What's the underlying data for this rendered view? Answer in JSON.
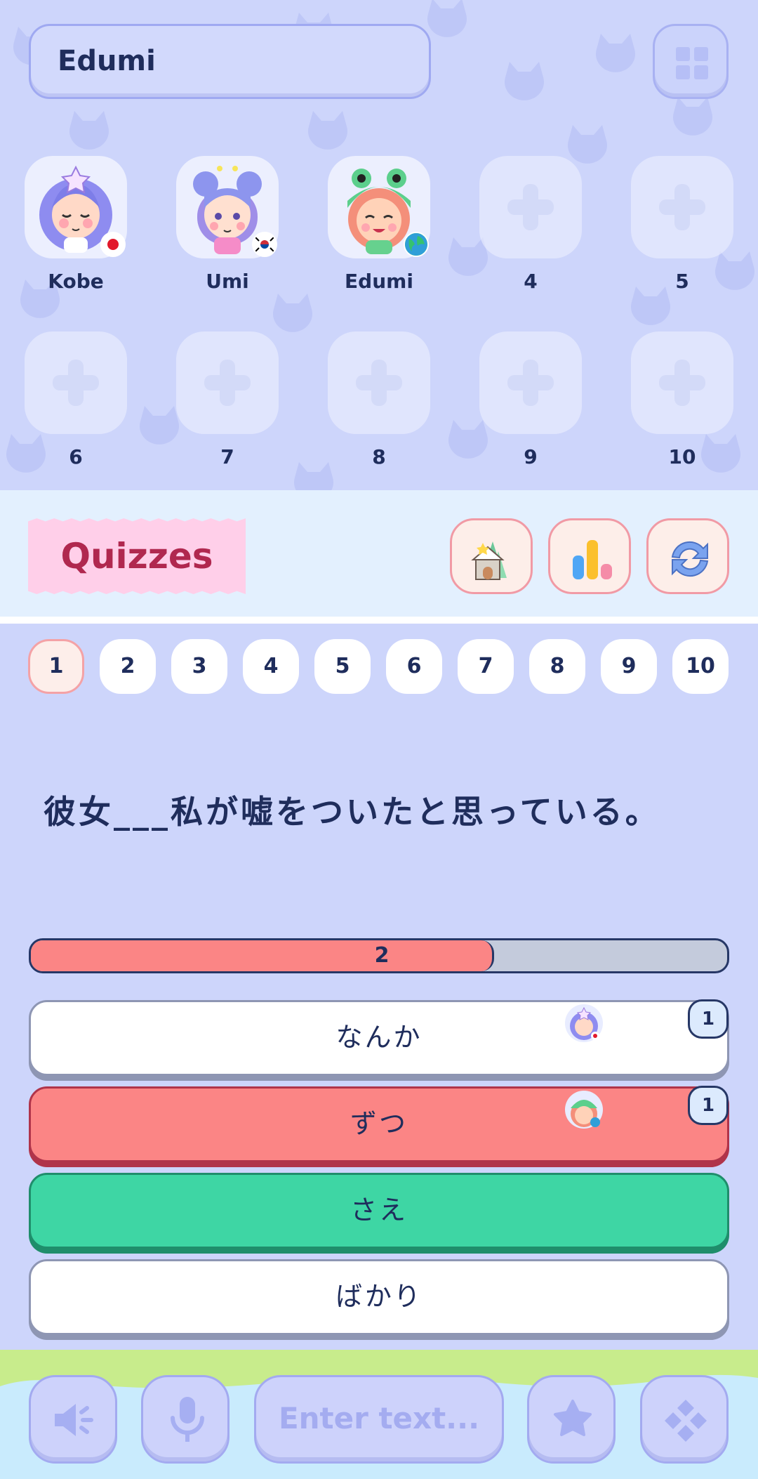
{
  "room": {
    "title": "Edumi"
  },
  "players": [
    {
      "label": "Kobe",
      "avatar": "girl-star-avatar",
      "flag": "japan-flag"
    },
    {
      "label": "Umi",
      "avatar": "girl-buns-avatar",
      "flag": "korea-flag"
    },
    {
      "label": "Edumi",
      "avatar": "frog-hat-avatar",
      "flag": "globe-flag"
    },
    {
      "label": "4"
    },
    {
      "label": "5"
    },
    {
      "label": "6"
    },
    {
      "label": "7"
    },
    {
      "label": "8"
    },
    {
      "label": "9"
    },
    {
      "label": "10"
    }
  ],
  "section": {
    "title": "Quizzes",
    "buttons": [
      "home-icon",
      "stats-icon",
      "refresh-icon"
    ]
  },
  "quiz_numbers": [
    "1",
    "2",
    "3",
    "4",
    "5",
    "6",
    "7",
    "8",
    "9",
    "10"
  ],
  "active_quiz": "1",
  "question": "彼女___私が嘘をついたと思っている。",
  "progress": {
    "label": "2",
    "fraction": 0.665
  },
  "answers": [
    {
      "text": "なんか",
      "state": "white",
      "count": "1",
      "picked_by": "Kobe"
    },
    {
      "text": "ずつ",
      "state": "red",
      "count": "1",
      "picked_by": "Edumi"
    },
    {
      "text": "さえ",
      "state": "green"
    },
    {
      "text": "ばかり",
      "state": "white"
    }
  ],
  "footer": {
    "input_placeholder": "Enter text...",
    "icons": [
      "speaker-icon",
      "microphone-icon",
      "star-icon",
      "gamepad-icon"
    ]
  },
  "colors": {
    "background": "#cdd5fb",
    "accent_pink": "#ffcfe9",
    "correct": "#3ed6a4",
    "wrong": "#fb8585",
    "text": "#1f2d5c"
  }
}
